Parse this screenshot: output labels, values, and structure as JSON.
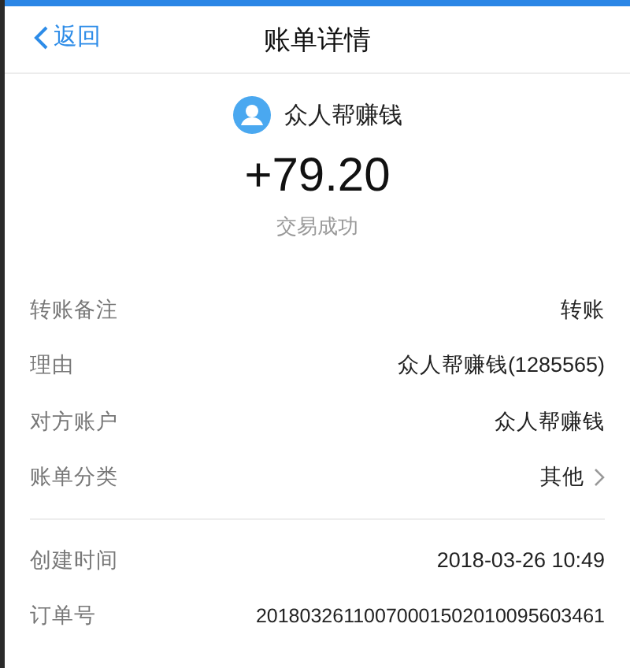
{
  "nav": {
    "back": "返回",
    "title": "账单详情"
  },
  "summary": {
    "payee": "众人帮赚钱",
    "amount": "+79.20",
    "status": "交易成功"
  },
  "sections": [
    {
      "rows": [
        {
          "label": "转账备注",
          "value": "转账",
          "kind": "plain"
        },
        {
          "label": "理由",
          "value": "众人帮赚钱(1285565)",
          "kind": "plain"
        },
        {
          "label": "对方账户",
          "value": "众人帮赚钱",
          "kind": "plain"
        },
        {
          "label": "账单分类",
          "value": "其他",
          "kind": "link"
        }
      ]
    },
    {
      "rows": [
        {
          "label": "创建时间",
          "value": "2018-03-26 10:49",
          "kind": "plain"
        },
        {
          "label": "订单号",
          "value": "20180326110070001502010095603461",
          "kind": "plain"
        }
      ]
    }
  ]
}
